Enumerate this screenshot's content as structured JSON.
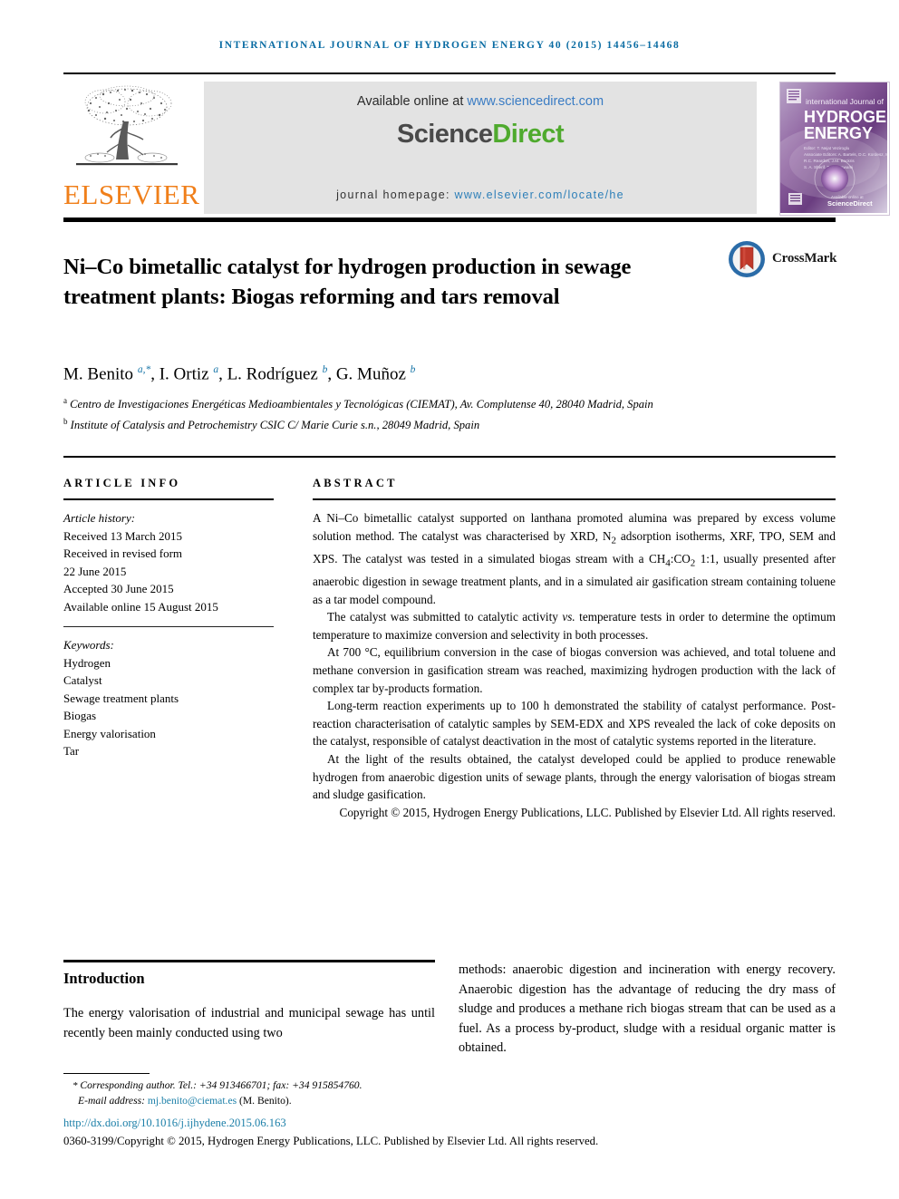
{
  "running_head": "International Journal of Hydrogen Energy 40 (2015) 14456–14468",
  "masthead": {
    "publisher_wordmark": "ELSEVIER",
    "available_prefix": "Available online at ",
    "available_url": "www.sciencedirect.com",
    "sciencedirect_part1": "Science",
    "sciencedirect_part2": "Direct",
    "homepage_label": "journal homepage: ",
    "homepage_url": "www.elsevier.com/locate/he",
    "cover": {
      "line1": "international Journal of",
      "line2": "HYDROGEN",
      "line3": "ENERGY",
      "footer": "ScienceDirect"
    }
  },
  "article": {
    "title": "Ni–Co bimetallic catalyst for hydrogen production in sewage treatment plants: Biogas reforming and tars removal",
    "crossmark_label": "CrossMark",
    "authors_html": "M. Benito <sup>a,*</sup>, I. Ortiz <sup>a</sup>, L. Rodríguez <sup>b</sup>, G. Muñoz <sup>b</sup>",
    "affiliations": [
      "Centro de Investigaciones Energéticas Medioambientales y Tecnológicas (CIEMAT), Av. Complutense 40, 28040 Madrid, Spain",
      "Institute of Catalysis and Petrochemistry CSIC C/ Marie Curie s.n., 28049 Madrid, Spain"
    ],
    "affiliation_marks": [
      "a",
      "b"
    ]
  },
  "article_info": {
    "heading": "Article info",
    "history_label": "Article history:",
    "history": [
      "Received 13 March 2015",
      "Received in revised form",
      "22 June 2015",
      "Accepted 30 June 2015",
      "Available online 15 August 2015"
    ],
    "keywords_label": "Keywords:",
    "keywords": [
      "Hydrogen",
      "Catalyst",
      "Sewage treatment plants",
      "Biogas",
      "Energy valorisation",
      "Tar"
    ]
  },
  "abstract": {
    "heading": "Abstract",
    "paragraph1_html": "A Ni–Co bimetallic catalyst supported on lanthana promoted alumina was prepared by excess volume solution method. The catalyst was characterised by XRD, N<sub>2</sub> adsorption isotherms, XRF, TPO, SEM and XPS. The catalyst was tested in a simulated biogas stream with a CH<sub>4</sub>:CO<sub>2</sub> 1:1, usually presented after anaerobic digestion in sewage treatment plants, and in a simulated air gasification stream containing toluene as a tar model compound.",
    "paragraph2_html": "The catalyst was submitted to catalytic activity <i>vs.</i> temperature tests in order to determine the optimum temperature to maximize conversion and selectivity in both processes.",
    "paragraph3_html": "At 700 °C, equilibrium conversion in the case of biogas conversion was achieved, and total toluene and methane conversion in gasification stream was reached, maximizing hydrogen production with the lack of complex tar by-products formation.",
    "paragraph4_html": "Long-term reaction experiments up to 100 h demonstrated the stability of catalyst performance. Post-reaction characterisation of catalytic samples by SEM-EDX and XPS revealed the lack of coke deposits on the catalyst, responsible of catalyst deactivation in the most of catalytic systems reported in the literature.",
    "paragraph5_html": "At the light of the results obtained, the catalyst developed could be applied to produce renewable hydrogen from anaerobic digestion units of sewage plants, through the energy valorisation of biogas stream and sludge gasification.",
    "copyright": "Copyright © 2015, Hydrogen Energy Publications, LLC. Published by Elsevier Ltd. All rights reserved."
  },
  "body": {
    "intro_heading": "Introduction",
    "left_text": "The energy valorisation of industrial and municipal sewage has until recently been mainly conducted using two",
    "right_text": "methods: anaerobic digestion and incineration with energy recovery. Anaerobic digestion has the advantage of reducing the dry mass of sludge and produces a methane rich biogas stream that can be used as a fuel. As a process by-product, sludge with a residual organic matter is obtained."
  },
  "footer": {
    "corresponding_star": "*",
    "corresponding_text": "Corresponding author. Tel.: +34 913466701; fax: +34 915854760.",
    "email_label": "E-mail address: ",
    "email": "mj.benito@ciemat.es",
    "email_suffix": " (M. Benito).",
    "doi": "http://dx.doi.org/10.1016/j.ijhydene.2015.06.163",
    "issn_line": "0360-3199/Copyright © 2015, Hydrogen Energy Publications, LLC. Published by Elsevier Ltd. All rights reserved."
  },
  "colors": {
    "running_head": "#0a6ca3",
    "elsevier_orange": "#F07F1A",
    "sciencedirect_green": "#4faa2e",
    "link_blue": "#2d7fb8",
    "link_teal": "#1b7fa8",
    "affiliation_mark_blue": "#1976a8"
  }
}
